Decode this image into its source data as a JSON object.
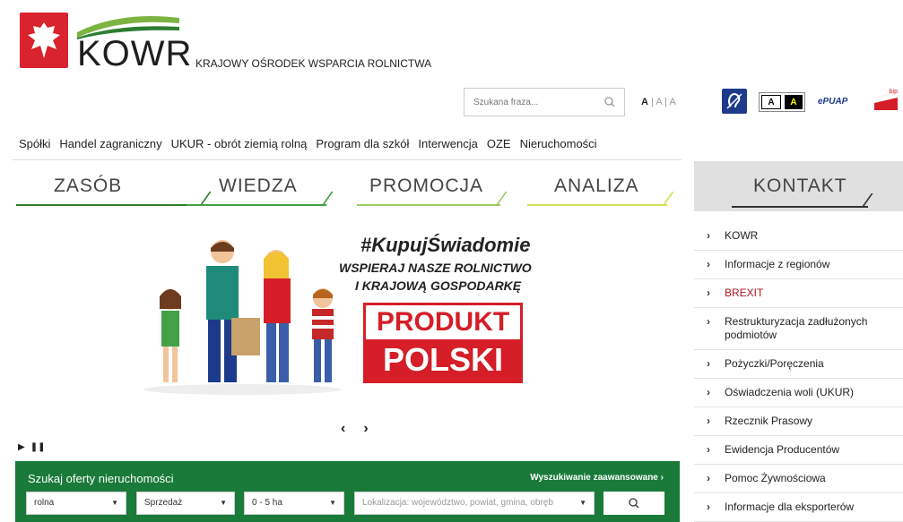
{
  "header": {
    "logo_text": "KOWR",
    "org_name": "KRAJOWY OŚRODEK WSPARCIA ROLNICTWA",
    "search_placeholder": "Szukana fraza...",
    "font_size_a1": "A",
    "font_size_a2": "A",
    "font_size_a3": "A",
    "contrast_a": "A",
    "contrast_b": "A",
    "epuap_label": "ePUAP",
    "bip_label": "bip"
  },
  "topnav": [
    "Spółki",
    "Handel zagraniczny",
    "UKUR - obrót ziemią rolną",
    "Program dla szkół",
    "Interwencja",
    "OZE",
    "Nieruchomości"
  ],
  "tabs": [
    {
      "label": "ZASÓB",
      "color": "#2e7d32"
    },
    {
      "label": "WIEDZA",
      "color": "#43a047"
    },
    {
      "label": "PROMOCJA",
      "color": "#9ccc65"
    },
    {
      "label": "ANALIZA",
      "color": "#d4e157"
    }
  ],
  "kontakt": "KONTAKT",
  "banner": {
    "hashtag": "#KupujŚwiadomie",
    "line1": "WSPIERAJ NASZE ROLNICTWO",
    "line2": "I KRAJOWĄ GOSPODARKĘ",
    "badge_top": "PRODUKT",
    "badge_bottom": "POLSKI"
  },
  "carousel": {
    "prev": "‹",
    "next": "›",
    "play": "▶",
    "pause": "❚❚"
  },
  "property_search": {
    "title": "Szukaj oferty nieruchomości",
    "advanced": "Wyszukiwanie zaawansowane",
    "type": "rolna",
    "transaction": "Sprzedaż",
    "area": "0 - 5 ha",
    "location_placeholder": "Lokalizacja: województwo, powiat, gmina, obręb"
  },
  "sidebar_links": [
    {
      "label": "KOWR",
      "highlight": false
    },
    {
      "label": "Informacje z regionów",
      "highlight": false
    },
    {
      "label": "BREXIT",
      "highlight": true
    },
    {
      "label": "Restrukturyzacja zadłużonych podmiotów",
      "highlight": false
    },
    {
      "label": "Pożyczki/Poręczenia",
      "highlight": false
    },
    {
      "label": "Oświadczenia woli (UKUR)",
      "highlight": false
    },
    {
      "label": "Rzecznik Prasowy",
      "highlight": false
    },
    {
      "label": "Ewidencja Producentów",
      "highlight": false
    },
    {
      "label": "Pomoc Żywnościowa",
      "highlight": false
    },
    {
      "label": "Informacje dla eksporterów",
      "highlight": false
    }
  ],
  "colors": {
    "brand_green": "#1a7a3a",
    "brand_red": "#d51e28"
  }
}
